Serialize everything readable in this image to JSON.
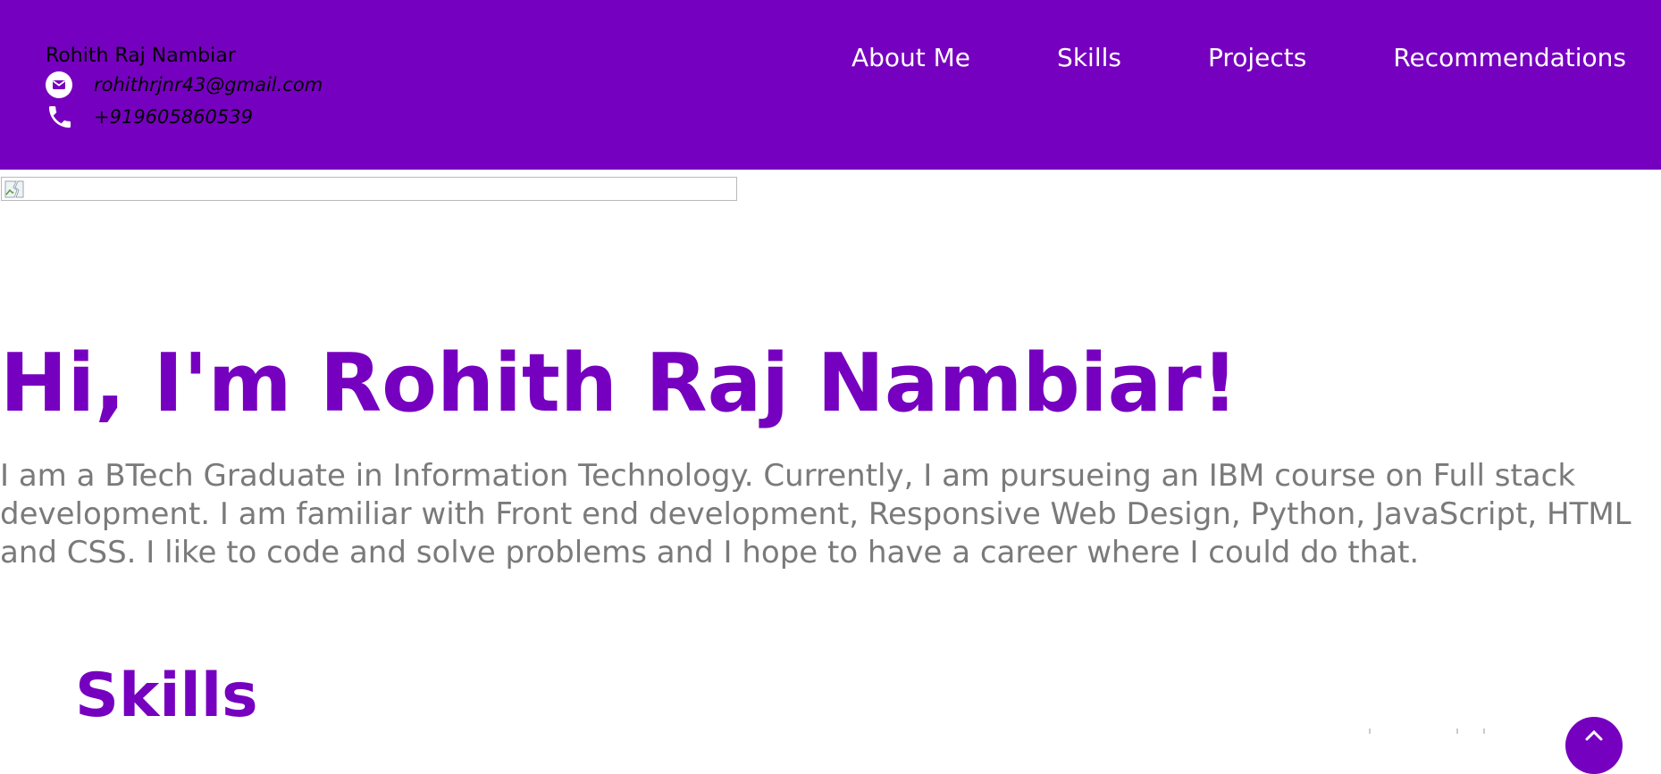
{
  "header": {
    "name": "Rohith Raj Nambiar",
    "email": "rohithrjnr43@gmail.com",
    "phone": "+919605860539",
    "email_icon": "mail-icon",
    "phone_icon": "phone-icon",
    "background_color": "#7600bf"
  },
  "nav": {
    "items": [
      {
        "label": "About Me"
      },
      {
        "label": "Skills"
      },
      {
        "label": "Projects"
      },
      {
        "label": "Recommendations"
      }
    ]
  },
  "hero": {
    "title": "Hi, I'm Rohith Raj Nambiar!",
    "text": "I am a BTech Graduate in Information Technology. Currently, I am pursueing an IBM course on Full stack development. I am familiar with Front end development, Responsive Web Design, Python, JavaScript, HTML and CSS. I like to code and solve problems and I hope to have a career where I could do that."
  },
  "skills": {
    "title": "Skills"
  },
  "scroll_top": {
    "icon": "chevron-up-icon"
  },
  "colors": {
    "accent": "#7600bf",
    "body_text": "#7a7a7a",
    "nav_text": "#ffffff"
  }
}
